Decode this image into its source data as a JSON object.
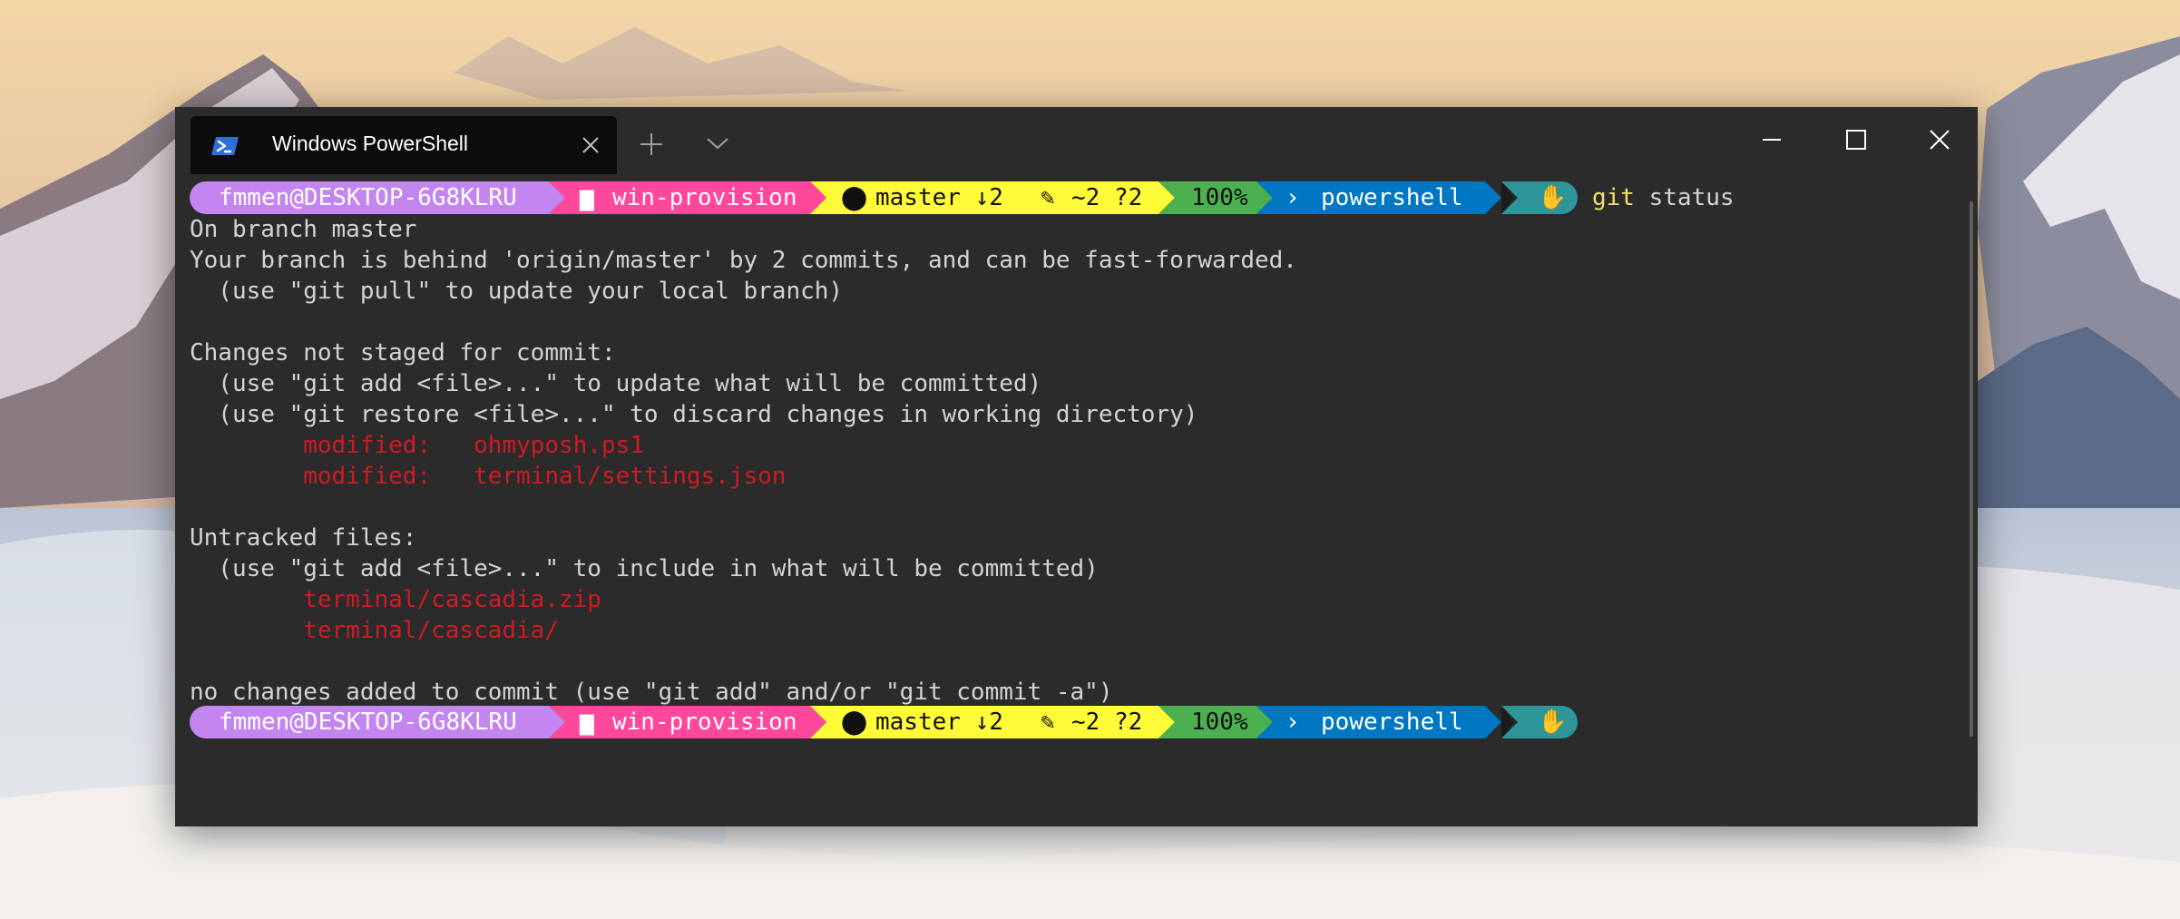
{
  "tab": {
    "title": "Windows PowerShell",
    "icon": "powershell-icon"
  },
  "window_controls": [
    "minimize-icon",
    "maximize-icon",
    "close-icon"
  ],
  "prompt": {
    "user": "fmmen@DESKTOP-6G8KLRU",
    "folder": "win-provision",
    "branch": "master ↓2 ",
    "git_status": "~2 ?2",
    "battery": "100%",
    "shell": "powershell",
    "colors": {
      "user": "#c386f1",
      "folder": "#ff479c",
      "git": "#fffb38",
      "battery": "#4caf50",
      "shell": "#0077c2",
      "exit": "#2e9599"
    }
  },
  "command": {
    "git": "git",
    "rest": " status"
  },
  "output": [
    {
      "text": "On branch master",
      "style": "normal"
    },
    {
      "text": "Your branch is behind 'origin/master' by 2 commits, and can be fast-forwarded.",
      "style": "normal"
    },
    {
      "text": "  (use \"git pull\" to update your local branch)",
      "style": "normal"
    },
    {
      "text": "",
      "style": "normal"
    },
    {
      "text": "Changes not staged for commit:",
      "style": "normal"
    },
    {
      "text": "  (use \"git add <file>...\" to update what will be committed)",
      "style": "normal"
    },
    {
      "text": "  (use \"git restore <file>...\" to discard changes in working directory)",
      "style": "normal"
    },
    {
      "text": "        modified:   ohmyposh.ps1",
      "style": "red"
    },
    {
      "text": "        modified:   terminal/settings.json",
      "style": "red"
    },
    {
      "text": "",
      "style": "normal"
    },
    {
      "text": "Untracked files:",
      "style": "normal"
    },
    {
      "text": "  (use \"git add <file>...\" to include in what will be committed)",
      "style": "normal"
    },
    {
      "text": "        terminal/cascadia.zip",
      "style": "red"
    },
    {
      "text": "        terminal/cascadia/",
      "style": "red"
    },
    {
      "text": "",
      "style": "normal"
    },
    {
      "text": "no changes added to commit (use \"git add\" and/or \"git commit -a\")",
      "style": "normal"
    }
  ]
}
